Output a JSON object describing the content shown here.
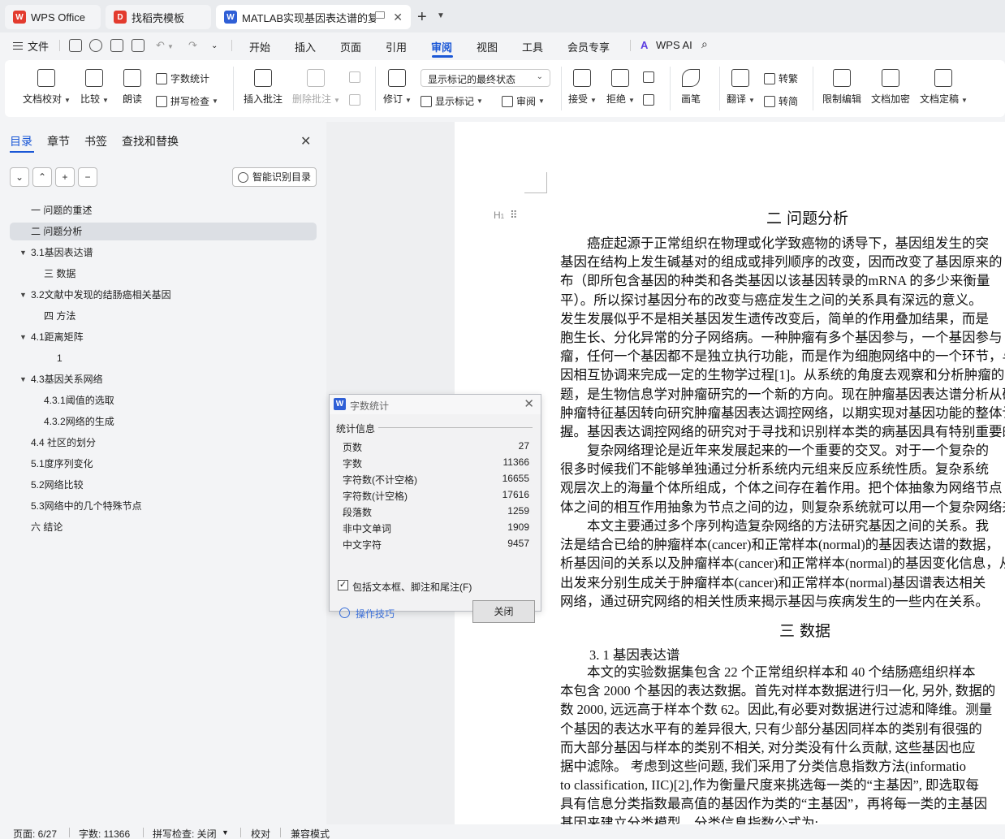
{
  "tabs": [
    {
      "label": "WPS Office",
      "icon": "wps-logo-icon",
      "color": "#e33b2e"
    },
    {
      "label": "找稻壳模板",
      "icon": "docer-icon",
      "color": "#e33b2e"
    },
    {
      "label": "MATLAB实现基因表达谱的复",
      "icon": "word-doc-icon",
      "color": "#2f5fd6"
    }
  ],
  "menubar": {
    "file": "文件",
    "items": [
      "开始",
      "插入",
      "页面",
      "引用",
      "审阅",
      "视图",
      "工具",
      "会员专享"
    ],
    "active": "审阅",
    "wps_ai": "WPS AI"
  },
  "ribbon": {
    "doc_check": "文档校对",
    "compare": "比较",
    "read_aloud": "朗读",
    "word_count": "字数统计",
    "spell_check": "拼写检查",
    "insert_comment": "插入批注",
    "delete_comment": "删除批注",
    "track_changes": "修订",
    "markup_mode": "显示标记的最终状态",
    "show_markup": "显示标记",
    "review": "审阅",
    "accept": "接受",
    "reject": "拒绝",
    "pen": "画笔",
    "translate": "翻译",
    "to_traditional": "转繁",
    "to_simplified": "转简",
    "restrict_edit": "限制编辑",
    "encrypt": "文档加密",
    "finalize": "文档定稿"
  },
  "nav": {
    "tabs": [
      "目录",
      "章节",
      "书签",
      "查找和替换"
    ],
    "smart_toc": "智能识别目录",
    "toc": [
      {
        "label": "一 问题的重述",
        "level": 1,
        "expandable": false
      },
      {
        "label": "二 问题分析",
        "level": 1,
        "expandable": false,
        "selected": true
      },
      {
        "label": "3.1基因表达谱",
        "level": 1,
        "expandable": true
      },
      {
        "label": "三 数据",
        "level": 2,
        "expandable": false
      },
      {
        "label": "3.2文献中发现的结肠癌相关基因",
        "level": 1,
        "expandable": true
      },
      {
        "label": "四 方法",
        "level": 2,
        "expandable": false
      },
      {
        "label": "4.1距离矩阵",
        "level": 1,
        "expandable": true
      },
      {
        "label": "1",
        "level": 3,
        "expandable": false
      },
      {
        "label": "4.3基因关系网络",
        "level": 1,
        "expandable": true
      },
      {
        "label": "4.3.1阈值的选取",
        "level": 2,
        "expandable": false
      },
      {
        "label": "4.3.2网络的生成",
        "level": 2,
        "expandable": false
      },
      {
        "label": "4.4 社区的划分",
        "level": 1,
        "expandable": false
      },
      {
        "label": "5.1度序列变化",
        "level": 1,
        "expandable": false
      },
      {
        "label": "5.2网络比较",
        "level": 1,
        "expandable": false
      },
      {
        "label": "5.3网络中的几个特殊节点",
        "level": 1,
        "expandable": false
      },
      {
        "label": "六 结论",
        "level": 1,
        "expandable": false
      }
    ]
  },
  "document": {
    "heading1": "二 问题分析",
    "para1": [
      "　　癌症起源于正常组织在物理或化学致癌物的诱导下，基因组发生的突",
      "基因在结构上发生碱基对的组成或排列顺序的改变，因而改变了基因原来的",
      "布（即所包含基因的种类和各类基因以该基因转录的mRNA 的多少来衡量",
      "平）。所以探讨基因分布的改变与癌症发生之间的关系具有深远的意义。",
      "发生发展似乎不是相关基因发生遗传改变后，简单的作用叠加结果，而是",
      "胞生长、分化异常的分子网络病。一种肿瘤有多个基因参与，一个基因参与",
      "瘤，任何一个基因都不是独立执行功能，而是作为细胞网络中的一个环节，与",
      "因相互协调来完成一定的生物学过程[1]。从系统的角度去观察和分析肿瘤的生",
      "题，是生物信息学对肿瘤研究的一个新的方向。现在肿瘤基因表达谱分析从研",
      "肿瘤特征基因转向研究肿瘤基因表达调控网络，以期实现对基因功能的整体认",
      "握。基因表达调控网络的研究对于寻找和识别样本类的病基因具有特别重要的"
    ],
    "para2": [
      "　　复杂网络理论是近年来发展起来的一个重要的交叉。对于一个复杂的",
      "很多时候我们不能够单独通过分析系统内元组来反应系统性质。复杂系统",
      "观层次上的海量个体所组成，个体之间存在着作用。把个体抽象为网络节点",
      "体之间的相互作用抽象为节点之间的边，则复杂系统就可以用一个复杂网络来"
    ],
    "para3": [
      "　　本文主要通过多个序列构造复杂网络的方法研究基因之间的关系。我",
      "法是结合已给的肿瘤样本(cancer)和正常样本(normal)的基因表达谱的数据，",
      "析基因间的关系以及肿瘤样本(cancer)和正常样本(normal)的基因变化信息，从",
      "出发来分别生成关于肿瘤样本(cancer)和正常样本(normal)基因谱表达相关",
      "网络，通过研究网络的相关性质来揭示基因与疾病发生的一些内在关系。"
    ],
    "heading2": "三 数据",
    "sub31": "3. 1  基因表达谱",
    "para4": [
      "　　本文的实验数据集包含 22 个正常组织样本和 40 个结肠癌组织样本",
      "本包含 2000 个基因的表达数据。首先对样本数据进行归一化, 另外, 数据的",
      "数 2000, 远远高于样本个数 62。因此,有必要对数据进行过滤和降维。测量",
      "个基因的表达水平有的差异很大, 只有少部分基因同样本的类别有很强的",
      "而大部分基因与样本的类别不相关, 对分类没有什么贡献, 这些基因也应",
      "据中滤除。 考虑到这些问题, 我们采用了分类信息指数方法(informatio",
      "to classification, IIC)[2],作为衡量尺度来挑选每一类的“主基因”, 即选取每",
      "具有信息分类指数最高值的基因作为类的“主基因”，再将每一类的主基因",
      "基因来建立分类模型。分类信息指数公式为:"
    ]
  },
  "dialog": {
    "title": "字数统计",
    "section": "统计信息",
    "rows": [
      {
        "label": "页数",
        "value": "27"
      },
      {
        "label": "字数",
        "value": "11366"
      },
      {
        "label": "字符数(不计空格)",
        "value": "16655"
      },
      {
        "label": "字符数(计空格)",
        "value": "17616"
      },
      {
        "label": "段落数",
        "value": "1259"
      },
      {
        "label": "非中文单词",
        "value": "1909"
      },
      {
        "label": "中文字符",
        "value": "9457"
      }
    ],
    "include_label": "包括文本框、脚注和尾注(F)",
    "include_checked": true,
    "tips": "操作技巧",
    "close": "关闭"
  },
  "statusbar": {
    "page": "页面: 6/27",
    "words": "字数: 11366",
    "spell": "拼写检查: 关闭",
    "proof": "校对",
    "compat": "兼容模式"
  },
  "colors": {
    "accent": "#1a57d6",
    "wps_red": "#e33b2e",
    "doc_blue": "#2f5fd6"
  }
}
